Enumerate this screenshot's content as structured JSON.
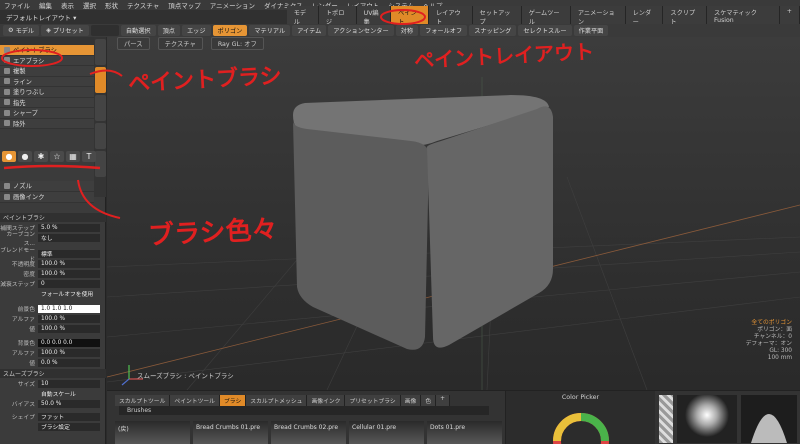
{
  "menubar": {
    "items": [
      "ファイル",
      "編集",
      "表示",
      "選択",
      "形状",
      "テクスチャ",
      "頂点マップ",
      "アニメーション",
      "ダイナミクス",
      "レンダー",
      "レイアウト",
      "システム",
      "ヘルプ"
    ]
  },
  "layout_bar": {
    "name": "デフォルトレイアウト ▾",
    "tabs": [
      "モデル",
      "トポロジ",
      "UV編集",
      "ペイント",
      "レイアウト",
      "セットアップ",
      "ゲームツール",
      "アニメーション",
      "レンダー",
      "スクリプト",
      "スケマティックFusion",
      "+"
    ],
    "active_tab": "ペイント"
  },
  "toolbar": {
    "model_label": "モデル",
    "preset_label": "プリセット",
    "auto_select": "自動選択",
    "vertex": "頂点",
    "edge": "エッジ",
    "polygon": "ポリゴン",
    "material": "マテリアル",
    "item": "アイテム",
    "action_center": "アクションセンター",
    "symmetry": "対称",
    "falloff": "フォールオフ",
    "snapping": "スナッピング",
    "select_through": "セレクトスルー",
    "work_plane": "作業平面"
  },
  "tools": [
    {
      "label": "ペイントブラシ",
      "selected": true
    },
    {
      "label": "エアブラシ",
      "selected": false
    },
    {
      "label": "複製",
      "selected": false
    },
    {
      "label": "ライン",
      "selected": false
    },
    {
      "label": "塗りつぶし",
      "selected": false
    },
    {
      "label": "指先",
      "selected": false
    },
    {
      "label": "シャープ",
      "selected": false
    },
    {
      "label": "除外",
      "selected": false
    },
    {
      "label": "ノズル",
      "selected": false
    },
    {
      "label": "画像インク",
      "selected": false
    }
  ],
  "shapes": [
    "●",
    "●",
    "✱",
    "☆",
    "▦",
    "T"
  ],
  "paint_brush": {
    "header": "ペイントブラシ",
    "interp_step_label": "補間ステップ",
    "interp_step_value": "5.0 %",
    "curve_label": "カーブコンス...",
    "curve_value": "なし",
    "blend_label": "ブレンドモード",
    "blend_value": "標準",
    "opacity_label": "不透明度",
    "opacity_value": "100.0 %",
    "density_label": "密度",
    "density_value": "100.0 %",
    "decay_label": "減衰ステップ",
    "decay_value": "0",
    "falloff_label": "フォールオフを使用",
    "fg_label": "前景色",
    "fg_value": "1.0   1.0   1.0",
    "fg_alpha_label": "アルファ",
    "fg_alpha_value": "100.0 %",
    "fg_val_label": "値",
    "fg_val_value": "100.0 %",
    "bg_label": "背景色",
    "bg_value": "0.0   0.0   0.0",
    "bg_alpha_label": "アルファ",
    "bg_alpha_value": "100.0 %",
    "bg_val_label": "値",
    "bg_val_value": "0.0 %"
  },
  "smooth_brush": {
    "header": "スムーズブラシ",
    "size_label": "サイズ",
    "size_value": "10",
    "auto_scale": "自動スケール",
    "bias_label": "バイアス",
    "bias_value": "50.0 %",
    "shape_label": "シェイプ",
    "shape_value": "ファット",
    "brush_settings": "ブラシ設定"
  },
  "viewport": {
    "mode_perspective": "パース",
    "mode_texture": "テクスチャ",
    "mode_ray": "Ray GL: オフ",
    "status": "スムーズブラシ : ペイントブラシ",
    "info_title": "全てのポリゴン",
    "info_lines": [
      "ポリゴン：面",
      "チャンネル：0",
      "デフォーマ：オン",
      "GL: 300",
      "100 mm"
    ]
  },
  "bottom_panel": {
    "tabs": [
      "スカルプトツール",
      "ペイントツール",
      "ブラシ",
      "スカルプトメッシュ",
      "画像インク",
      "プリセットブラシ",
      "画像",
      "色",
      "+"
    ],
    "active_tab": "ブラシ",
    "path": "Brushes",
    "thumbs": [
      "(戻)",
      "Bread Crumbs 01.pre",
      "Bread Crumbs 02.pre",
      "Cellular 01.pre",
      "Dots 01.pre"
    ],
    "color_picker_title": "Color Picker"
  },
  "annotations": {
    "paint_brush": "ペイントブラシ",
    "paint_layout": "ペイントレイアウト",
    "brush_color": "ブラシ色々"
  }
}
